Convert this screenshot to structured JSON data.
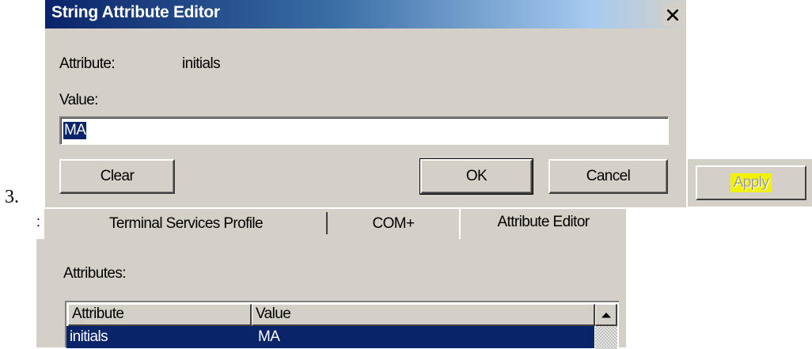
{
  "step_number": "3.",
  "dialog": {
    "title": "String Attribute Editor",
    "close_symbol": "close-icon",
    "attribute_label": "Attribute:",
    "attribute_value": "initials",
    "value_label": "Value:",
    "value_input": "MA",
    "buttons": {
      "clear": "Clear",
      "ok": "OK",
      "cancel": "Cancel"
    }
  },
  "apply_button": {
    "label": "Apply",
    "highlight_color": "#f2f200",
    "disabled": true
  },
  "tabs": [
    {
      "label": "Terminal Services Profile",
      "active": false
    },
    {
      "label": "COM+",
      "active": false
    },
    {
      "label": "Attribute Editor",
      "active": true
    }
  ],
  "attributes_panel": {
    "label": "Attributes:",
    "columns": [
      "Attribute",
      "Value"
    ],
    "rows": [
      {
        "attribute": "initials",
        "value": "MA",
        "selected": true
      }
    ],
    "scroll_up_icon": "triangle-up-icon"
  },
  "colors": {
    "title_bar_start": "#0a246a",
    "title_bar_end": "#a6caf0",
    "dialog_background": "#d4d0c8",
    "selection": "#0a246a"
  }
}
